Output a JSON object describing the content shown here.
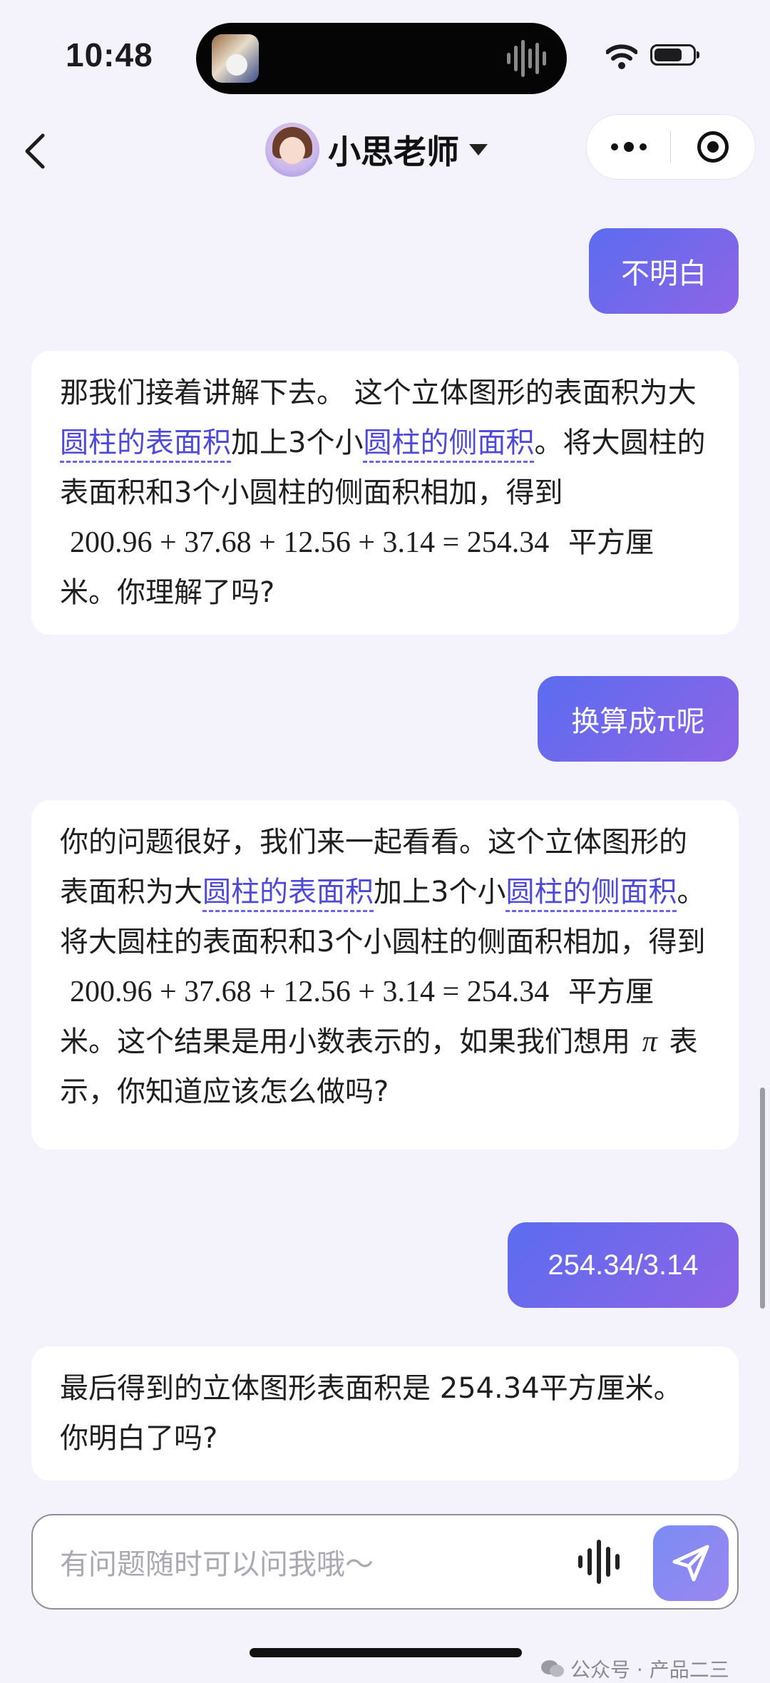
{
  "status_bar": {
    "time": "10:48"
  },
  "nav": {
    "title": "小思老师"
  },
  "messages": {
    "u1": "不明白",
    "a1": {
      "p1": "那我们接着讲解下去。 这个立体图形的表面积为大",
      "k1": "圆柱的表面积",
      "p2": "加上3个小",
      "k2": "圆柱的侧面积",
      "p3": "。将大圆柱的表面积和3个小圆柱的侧面积相加，得到 ",
      "formula": "200.96 + 37.68 + 12.56 + 3.14 = 254.34",
      "p4": " 平方厘米。你理解了吗?"
    },
    "u2": "换算成π呢",
    "a2": {
      "p1": "你的问题很好，我们来一起看看。这个立体图形的表面积为大",
      "k1": "圆柱的表面积",
      "p2": "加上3个小",
      "k2": "圆柱的侧面积",
      "p3": "。将大圆柱的表面积和3个小圆柱的侧面积相加，得到",
      "formula": "200.96 + 37.68 + 12.56 + 3.14 = 254.34",
      "p4": " 平方厘米。这个结果是用小数表示的，如果我们想用 ",
      "pi": "π",
      "p5": " 表示，你知道应该怎么做吗?"
    },
    "u3": "254.34/3.14",
    "a3": "最后得到的立体图形表面积是 254.34平方厘米。你明白了吗?"
  },
  "input": {
    "placeholder": "有问题随时可以问我哦～"
  },
  "watermark": "公众号 · 产品二三",
  "colors": {
    "accent": "#5b6cf0",
    "accent2": "#8e64e6",
    "keyword": "#4e49d6",
    "background": "#f4f3fb"
  }
}
